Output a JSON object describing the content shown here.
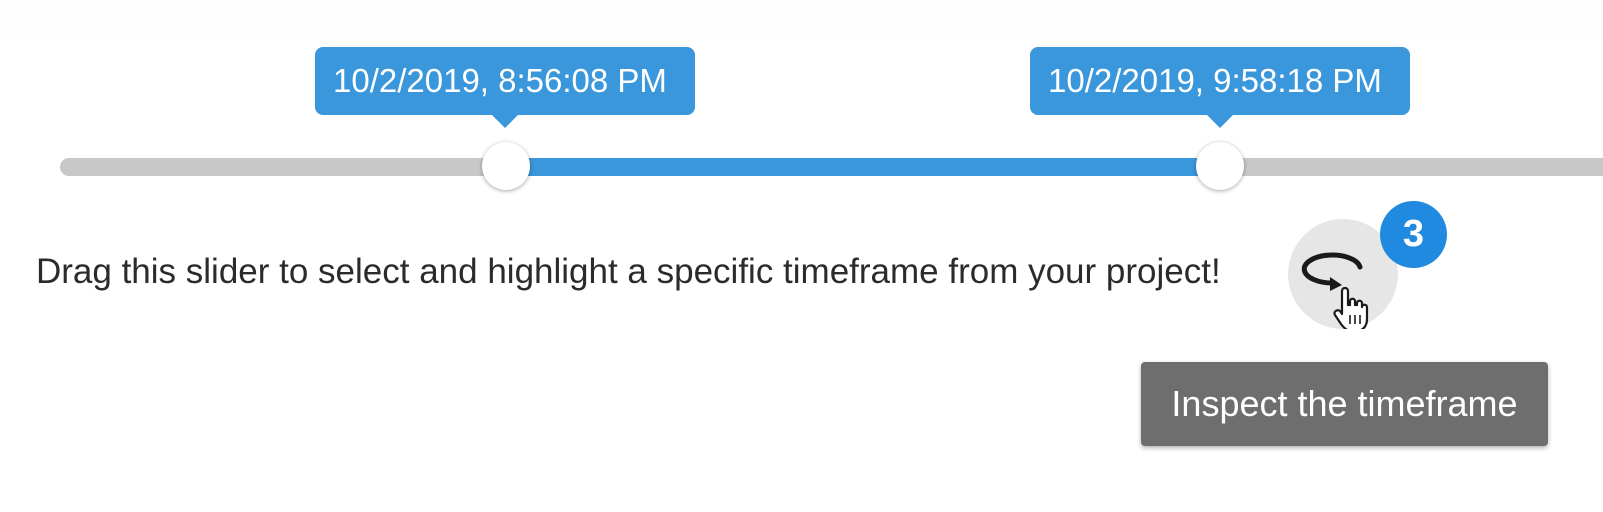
{
  "slider": {
    "start_label": "10/2/2019, 8:56:08 PM",
    "end_label": "10/2/2019, 9:58:18 PM"
  },
  "instruction": {
    "text": "Drag this slider to select and highlight a specific timeframe from your project!"
  },
  "inspect": {
    "icon": "inspect-timeframe-icon",
    "badge_count": "3",
    "tooltip": "Inspect the timeframe"
  },
  "colors": {
    "accent": "#3a97db",
    "badge": "#1f8ae0",
    "track": "#c8c8c8",
    "tooltip_bg": "#6e6e6e"
  }
}
